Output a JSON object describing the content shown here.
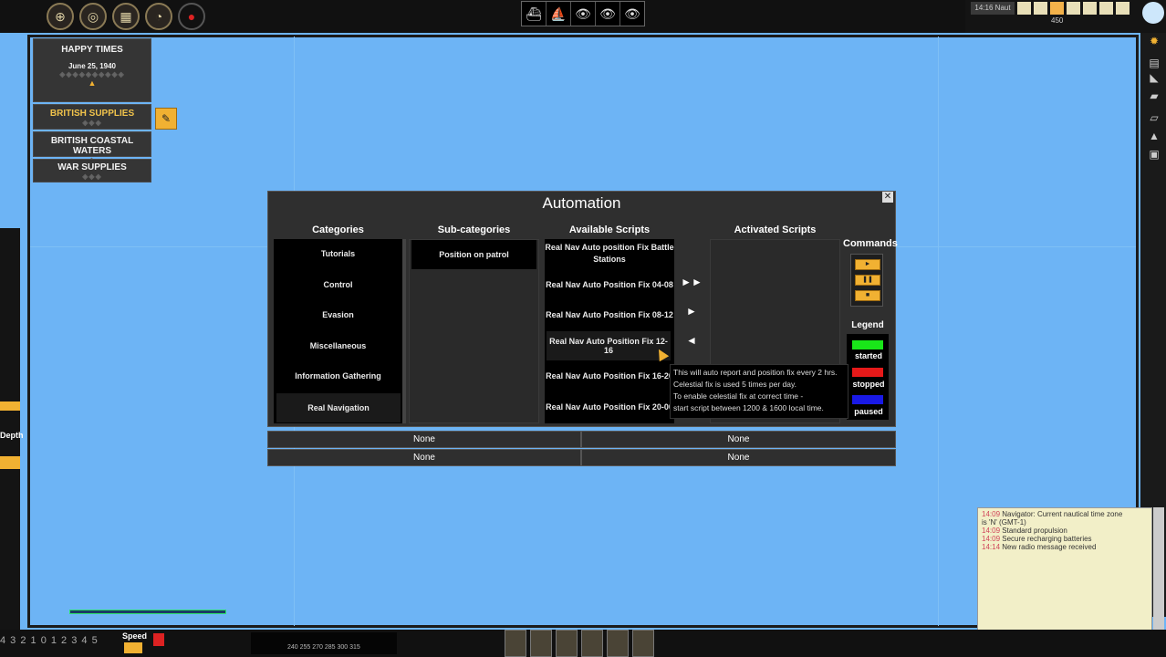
{
  "top_bar": {
    "icons": [
      "compass-icon",
      "target-icon",
      "chart-icon",
      "clock-icon",
      "record-icon"
    ],
    "view_buttons": [
      "ship-icon",
      "boat-icon",
      "periscope-eye-icon",
      "eye-icon",
      "eye-icon"
    ],
    "clock": "14:16 Naut",
    "compass_value": "450"
  },
  "missions": {
    "header_title": "HAPPY TIMES",
    "header_date": "June 25, 1940",
    "items": [
      {
        "label": "BRITISH SUPPLIES",
        "selected": true
      },
      {
        "label": "BRITISH COASTAL WATERS",
        "selected": false
      },
      {
        "label": "WAR SUPPLIES",
        "selected": false
      }
    ]
  },
  "dialog": {
    "title": "Automation",
    "close_label": "✕",
    "columns": {
      "categories": "Categories",
      "subcategories": "Sub-categories",
      "available": "Available Scripts",
      "activated": "Activated Scripts",
      "commands": "Commands",
      "legend": "Legend"
    },
    "categories": [
      "Tutorials",
      "Control",
      "Evasion",
      "Miscellaneous",
      "Information Gathering",
      "Real Navigation"
    ],
    "selected_category": "Real Navigation",
    "subcategories": [
      "Position on patrol"
    ],
    "available_scripts": [
      "Real Nav Auto position Fix Battle Stations",
      "Real Nav Auto Position Fix 04-08",
      "Real Nav Auto Position Fix 08-12",
      "Real Nav Auto Position Fix 12-16",
      "Real Nav Auto Position Fix 16-20",
      "Real Nav Auto Position Fix 20-00"
    ],
    "move_buttons": [
      "►►",
      "►",
      "◄"
    ],
    "command_buttons": [
      "►",
      "❚❚",
      "■"
    ],
    "legend": [
      {
        "label": "started",
        "color": "#19e619"
      },
      {
        "label": "stopped",
        "color": "#e61919"
      },
      {
        "label": "paused",
        "color": "#1919e6"
      }
    ],
    "tooltip": [
      "This will auto report and position fix every 2 hrs.",
      "Celestial fix is used 5 times per day.",
      "To enable celestial fix at correct time -",
      "start script between 1200 & 1600 local time."
    ],
    "status_rows": [
      [
        "None",
        "None"
      ],
      [
        "None",
        "None"
      ]
    ]
  },
  "message_log": {
    "entries": [
      {
        "time": "14:09",
        "text": "Navigator: Current nautical time zone"
      },
      {
        "time": "",
        "text": "is 'N' (GMT-1)"
      },
      {
        "time": "14:09",
        "text": "Standard propulsion"
      },
      {
        "time": "14:09",
        "text": "Secure recharging batteries"
      },
      {
        "time": "14:14",
        "text": "New radio message received"
      }
    ]
  },
  "bottom": {
    "speed_label": "Speed",
    "depth_label": "Depth",
    "gear_numbers": "4 3 2 1 0 1 2 3 4 5",
    "dial_ticks": "240 255 270 285 300 315"
  }
}
